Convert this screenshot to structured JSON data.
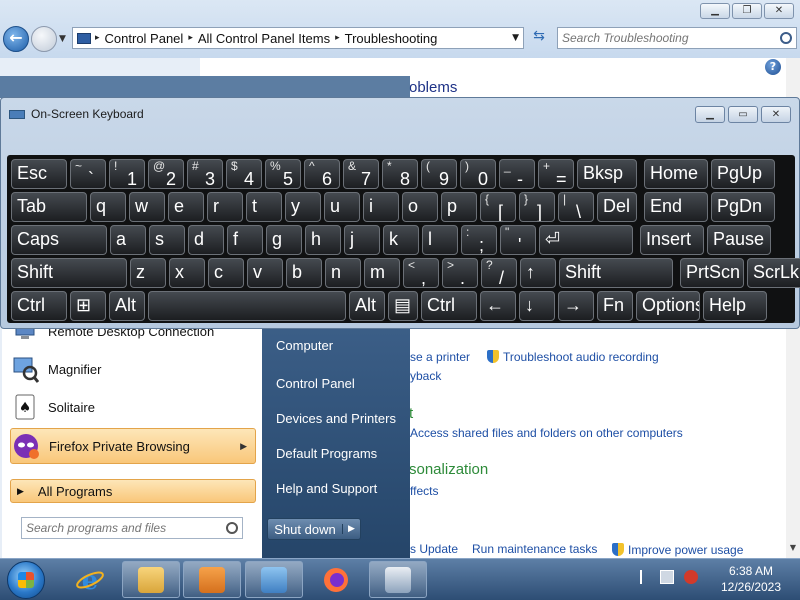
{
  "explorer": {
    "breadcrumbs": [
      "Control Panel",
      "All Control Panel Items",
      "Troubleshooting"
    ],
    "search_placeholder": "Search Troubleshooting",
    "heading_fragment": "oblems",
    "personalization_fragment": "sonalization",
    "network_fragment": "t",
    "links": {
      "use_printer": "se a printer",
      "troubleshoot_audio": "Troubleshoot audio recording",
      "playback": "yback",
      "access_shared": "Access shared files and folders on other computers",
      "effects": "ffects",
      "update": "s Update",
      "run_maintenance": "Run maintenance tasks",
      "improve_power": "Improve power usage"
    }
  },
  "osk": {
    "title": "On-Screen Keyboard",
    "rows": [
      [
        {
          "p": "Esc"
        },
        {
          "s": "~",
          "p": "`"
        },
        {
          "s": "!",
          "p": "1"
        },
        {
          "s": "@",
          "p": "2"
        },
        {
          "s": "#",
          "p": "3"
        },
        {
          "s": "$",
          "p": "4"
        },
        {
          "s": "%",
          "p": "5"
        },
        {
          "s": "^",
          "p": "6"
        },
        {
          "s": "&",
          "p": "7"
        },
        {
          "s": "*",
          "p": "8"
        },
        {
          "s": "(",
          "p": "9"
        },
        {
          "s": ")",
          "p": "0"
        },
        {
          "s": "_",
          "p": "-"
        },
        {
          "s": "+",
          "p": "="
        },
        {
          "p": "Bksp"
        },
        {
          "p": "Home"
        },
        {
          "p": "PgUp"
        }
      ],
      [
        {
          "p": "Tab"
        },
        {
          "p": "q"
        },
        {
          "p": "w"
        },
        {
          "p": "e"
        },
        {
          "p": "r"
        },
        {
          "p": "t"
        },
        {
          "p": "y"
        },
        {
          "p": "u"
        },
        {
          "p": "i"
        },
        {
          "p": "o"
        },
        {
          "p": "p"
        },
        {
          "s": "{",
          "p": "["
        },
        {
          "s": "}",
          "p": "]"
        },
        {
          "s": "|",
          "p": "\\"
        },
        {
          "p": "Del"
        },
        {
          "p": "End"
        },
        {
          "p": "PgDn"
        }
      ],
      [
        {
          "p": "Caps"
        },
        {
          "p": "a"
        },
        {
          "p": "s"
        },
        {
          "p": "d"
        },
        {
          "p": "f"
        },
        {
          "p": "g"
        },
        {
          "p": "h"
        },
        {
          "p": "j"
        },
        {
          "p": "k"
        },
        {
          "p": "l"
        },
        {
          "s": ":",
          "p": ";"
        },
        {
          "s": "\"",
          "p": "'"
        },
        {
          "p": "⏎"
        },
        {
          "p": "Insert"
        },
        {
          "p": "Pause"
        }
      ],
      [
        {
          "p": "Shift"
        },
        {
          "p": "z"
        },
        {
          "p": "x"
        },
        {
          "p": "c"
        },
        {
          "p": "v"
        },
        {
          "p": "b"
        },
        {
          "p": "n"
        },
        {
          "p": "m"
        },
        {
          "s": "<",
          "p": ","
        },
        {
          "s": ">",
          "p": "."
        },
        {
          "s": "?",
          "p": "/"
        },
        {
          "p": "↑"
        },
        {
          "p": "Shift"
        },
        {
          "p": "PrtScn"
        },
        {
          "p": "ScrLk"
        }
      ],
      [
        {
          "p": "Ctrl"
        },
        {
          "p": "⊞"
        },
        {
          "p": "Alt"
        },
        {
          "p": ""
        },
        {
          "p": "Alt"
        },
        {
          "p": "▤"
        },
        {
          "p": "Ctrl"
        },
        {
          "p": "←"
        },
        {
          "p": "↓"
        },
        {
          "p": "→"
        },
        {
          "p": "Fn"
        },
        {
          "p": "Options"
        },
        {
          "p": "Help"
        }
      ]
    ]
  },
  "start_menu": {
    "items": [
      "Remote Desktop Connection",
      "Magnifier",
      "Solitaire",
      "Firefox Private Browsing"
    ],
    "all_programs": "All Programs",
    "search_placeholder": "Search programs and files",
    "right_items": [
      "Computer",
      "Control Panel",
      "Devices and Printers",
      "Default Programs",
      "Help and Support"
    ],
    "shutdown": "Shut down"
  },
  "taskbar": {
    "time": "6:38 AM",
    "date": "12/26/2023"
  }
}
